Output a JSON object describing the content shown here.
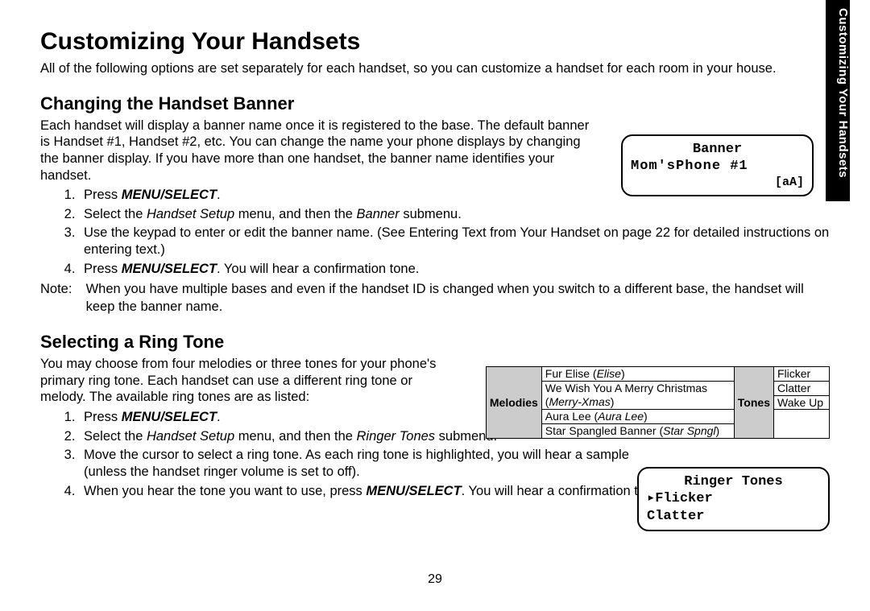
{
  "side_tab": "Customizing Your Handsets",
  "h1": "Customizing Your Handsets",
  "intro": "All of the following options are set separately for each handset, so you can customize a handset for each room in your house.",
  "sec1": {
    "title": "Changing the Handset Banner",
    "para": "Each handset will display a banner name once it is registered to the base. The default banner is Handset #1, Handset #2, etc. You can change the name your phone displays by changing the banner display. If you have more than one handset, the banner name identifies your handset.",
    "steps": {
      "s1a": "Press ",
      "s1b": "MENU/SELECT",
      "s1c": ".",
      "s2a": "Select the ",
      "s2b": "Handset Setup",
      "s2c": " menu, and then the ",
      "s2d": "Banner",
      "s2e": " submenu.",
      "s3": "Use the keypad to enter or edit the banner name. (See Entering Text from Your Handset on page 22 for detailed instructions on entering text.)",
      "s4a": "Press ",
      "s4b": "MENU/SELECT",
      "s4c": ". You will hear a confirmation tone."
    },
    "note_label": "Note:",
    "note": "When you have multiple bases and even if the handset ID is changed when you switch to a different base, the handset will keep the banner name."
  },
  "lcd_banner": {
    "l1": "Banner",
    "l2": "Mom'sPhone #1",
    "l3": "[aA]"
  },
  "sec2": {
    "title": "Selecting a Ring Tone",
    "para": "You may choose from four melodies or three tones for your phone's primary ring tone. Each handset can use a different ring tone or melody. The available ring tones are as listed:",
    "steps": {
      "s1a": "Press ",
      "s1b": "MENU/SELECT",
      "s1c": ".",
      "s2a": "Select the ",
      "s2b": "Handset Setup",
      "s2c": " menu, and then the ",
      "s2d": "Ringer Tones",
      "s2e": " submenu.",
      "s3": "Move the cursor to select a ring tone. As each ring tone is highlighted, you will hear a sample (unless the handset ringer volume is set to off).",
      "s4a": "When you hear the tone you want to use, press ",
      "s4b": "MENU/SELECT",
      "s4c": ". You will hear a confirmation tone."
    }
  },
  "tone_table": {
    "mel_hdr": "Melodies",
    "ton_hdr": "Tones",
    "m1a": "Fur Elise (",
    "m1b": "Elise",
    "m1c": ")",
    "m2a": "We Wish You A Merry Christmas (",
    "m2b": "Merry-Xmas",
    "m2c": ")",
    "m3a": "Aura Lee (",
    "m3b": "Aura Lee",
    "m3c": ")",
    "m4a": "Star Spangled Banner (",
    "m4b": "Star Spngl",
    "m4c": ")",
    "t1": "Flicker",
    "t2": "Clatter",
    "t3": "Wake Up"
  },
  "lcd_ring": {
    "l1": "Ringer Tones",
    "l2": "▸Flicker",
    "l3": " Clatter"
  },
  "page_number": "29"
}
